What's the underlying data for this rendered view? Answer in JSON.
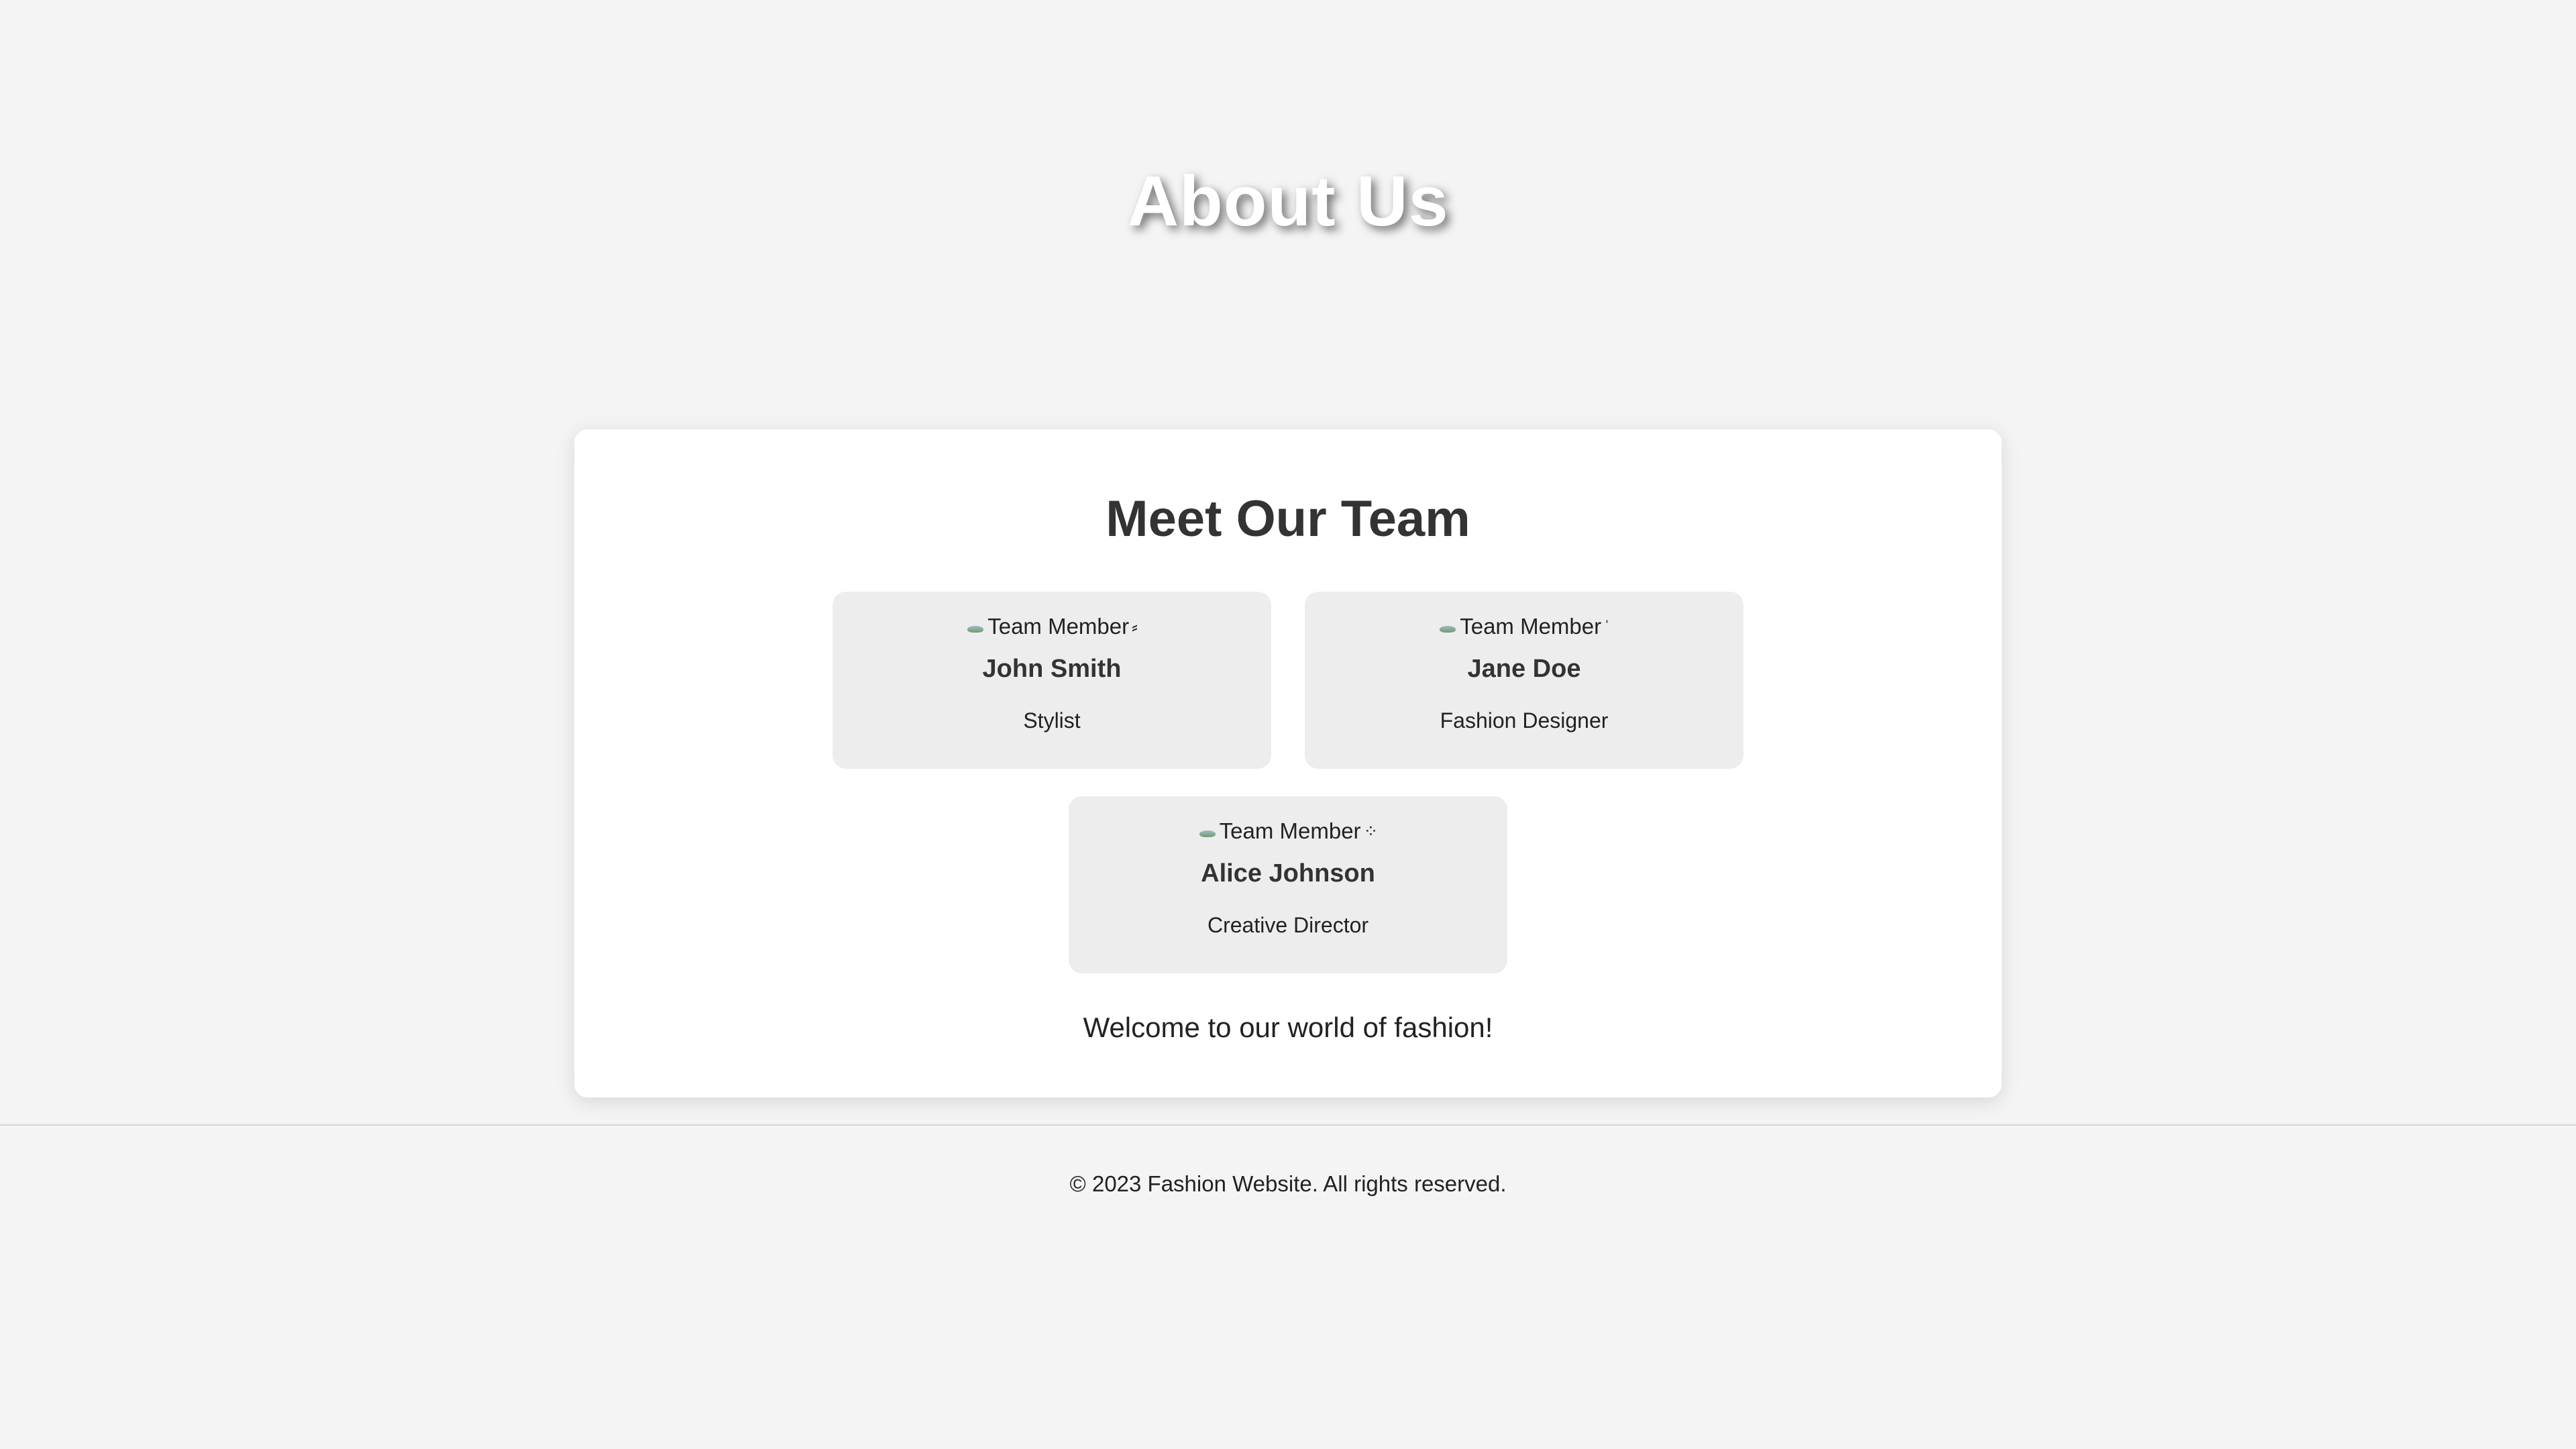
{
  "hero": {
    "title": "About Us"
  },
  "team": {
    "heading": "Meet Our Team",
    "members": [
      {
        "image_alt": "Team Member",
        "alt_suffix": "⸗",
        "name": "John Smith",
        "role": "Stylist"
      },
      {
        "image_alt": "Team Member",
        "alt_suffix": "ˈ",
        "name": "Jane Doe",
        "role": "Fashion Designer"
      },
      {
        "image_alt": "Team Member",
        "alt_suffix": "⁘",
        "name": "Alice Johnson",
        "role": "Creative Director"
      }
    ],
    "welcome": "Welcome to our world of fashion!"
  },
  "footer": {
    "text": "© 2023 Fashion Website. All rights reserved."
  },
  "colors": {
    "page_background": "#f4f4f4",
    "card_background": "#ffffff",
    "member_background": "#ededed",
    "heading_text": "#333333"
  }
}
